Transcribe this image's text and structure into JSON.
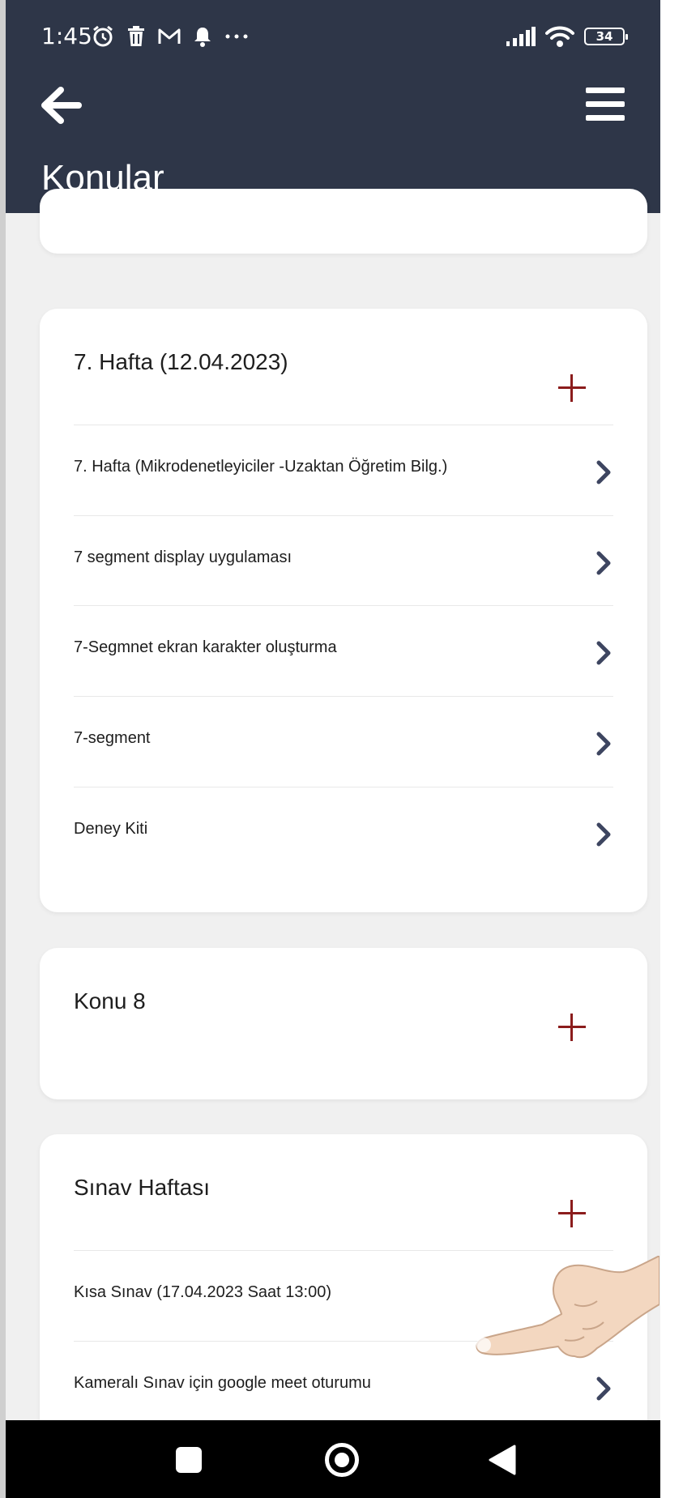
{
  "status_bar": {
    "time": "1:45",
    "battery": "34"
  },
  "header": {
    "title": "Konular"
  },
  "sections": [
    {
      "title": "7. Hafta (12.04.2023)",
      "items": [
        {
          "label": "7. Hafta (Mikrodenetleyiciler -Uzaktan Öğretim Bilg.)"
        },
        {
          "label": "7 segment display uygulaması"
        },
        {
          "label": "7-Segmnet ekran karakter oluşturma"
        },
        {
          "label": "7-segment"
        },
        {
          "label": "Deney Kiti"
        }
      ]
    },
    {
      "title": "Konu 8",
      "items": []
    },
    {
      "title": "Sınav Haftası",
      "items": [
        {
          "label": "Kısa Sınav (17.04.2023 Saat 13:00)"
        },
        {
          "label": "Kameralı Sınav için google meet oturumu"
        }
      ]
    }
  ],
  "colors": {
    "header_bg": "#2e3648",
    "accent_plus": "#8b1c1c",
    "chevron": "#3d4560",
    "page_bg": "#f0f0f0"
  },
  "icons": {
    "back": "arrow-left-icon",
    "menu": "hamburger-menu-icon",
    "add": "plus-icon",
    "item": "chevron-right-icon"
  }
}
